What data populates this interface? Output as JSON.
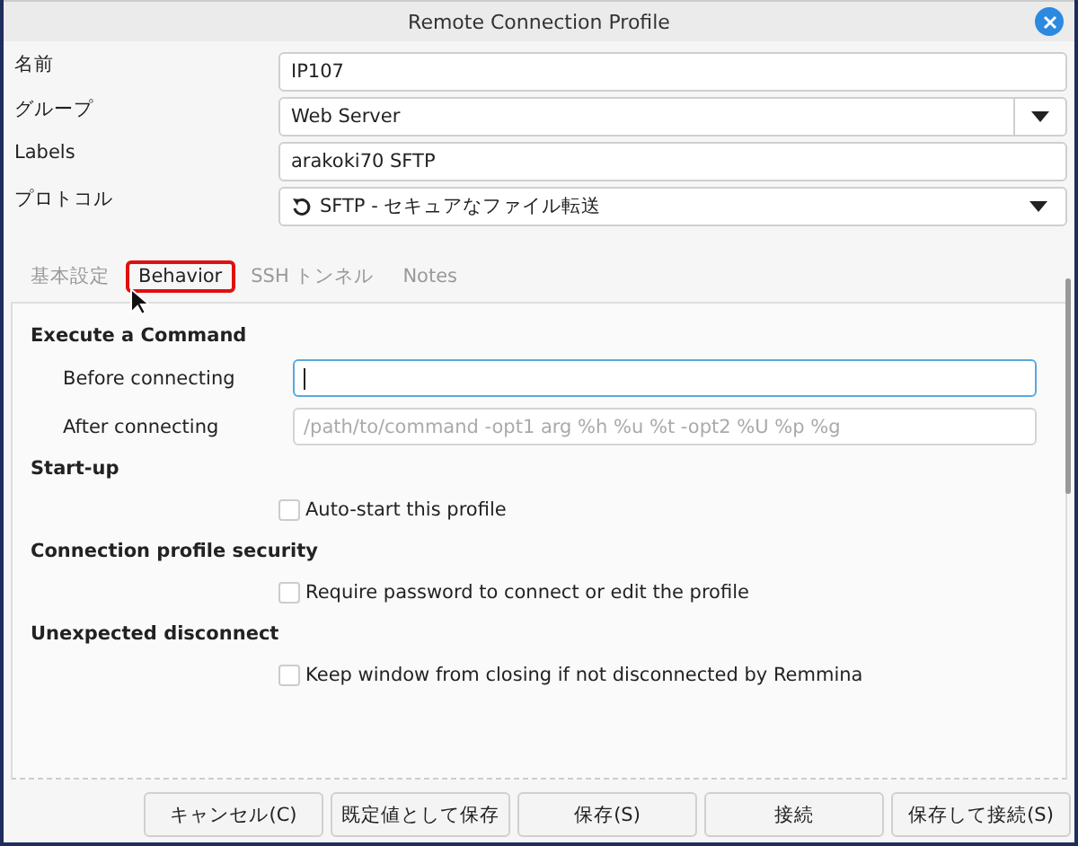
{
  "window": {
    "title": "Remote Connection Profile"
  },
  "fields": [
    {
      "label": "名前",
      "kind": "text",
      "value": "IP107"
    },
    {
      "label": "グループ",
      "kind": "combo",
      "value": "Web Server"
    },
    {
      "label": "Labels",
      "kind": "text",
      "value": "arakoki70 SFTP"
    },
    {
      "label": "プロトコル",
      "kind": "select",
      "value": "SFTP - セキュアなファイル転送"
    }
  ],
  "tabs": [
    {
      "label": "基本設定",
      "selected": false,
      "highlighted": false
    },
    {
      "label": "Behavior",
      "selected": true,
      "highlighted": true
    },
    {
      "label": "SSH トンネル",
      "selected": false,
      "highlighted": false
    },
    {
      "label": "Notes",
      "selected": false,
      "highlighted": false
    }
  ],
  "sections": [
    {
      "heading": "Execute a Command",
      "rows": [
        {
          "kind": "field",
          "label": "Before connecting",
          "value": "",
          "focused": true
        },
        {
          "kind": "field",
          "label": "After connecting",
          "placeholder": "/path/to/command -opt1 arg %h %u %t -opt2 %U %p %g",
          "focused": false
        }
      ]
    },
    {
      "heading": "Start-up",
      "rows": [
        {
          "kind": "checkbox",
          "label": "Auto-start this profile",
          "checked": false
        }
      ]
    },
    {
      "heading": "Connection profile security",
      "rows": [
        {
          "kind": "checkbox",
          "label": "Require password to connect or edit the profile",
          "checked": false
        }
      ]
    },
    {
      "heading": "Unexpected disconnect",
      "rows": [
        {
          "kind": "checkbox",
          "label": "Keep window from closing if not disconnected by Remmina",
          "checked": false
        }
      ]
    }
  ],
  "buttons": [
    "キャンセル(C)",
    "既定値として保存",
    "保存(S)",
    "接続",
    "保存して接続(S)"
  ]
}
